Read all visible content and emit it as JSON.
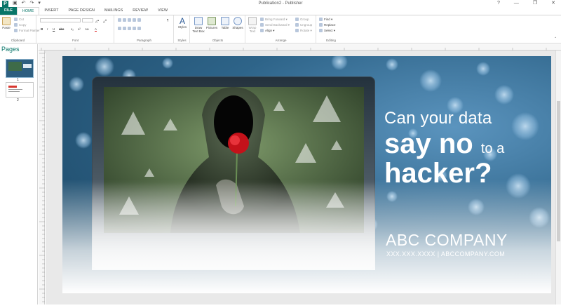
{
  "app": {
    "window_title": "Publication2 - Publisher",
    "colors": {
      "accent": "#077568",
      "ribbon_bg": "#ffffff",
      "workspace": "#e9e9e9"
    }
  },
  "qat": {
    "logo": "P",
    "save_icon": "save-icon",
    "undo": "↶",
    "redo": "↷"
  },
  "window_controls": {
    "help": "?",
    "minimize": "—",
    "restore": "❐",
    "close": "✕"
  },
  "tabs": [
    {
      "label": "FILE"
    },
    {
      "label": "HOME"
    },
    {
      "label": "INSERT"
    },
    {
      "label": "PAGE DESIGN"
    },
    {
      "label": "MAILINGS"
    },
    {
      "label": "REVIEW"
    },
    {
      "label": "VIEW"
    }
  ],
  "ribbon": {
    "clipboard": {
      "label": "Clipboard",
      "paste": "Paste",
      "cut": "Cut",
      "copy": "Copy",
      "format_painter": "Format Painter"
    },
    "font": {
      "label": "Font",
      "bold": "B",
      "italic": "I",
      "underline": "U",
      "strike": "abc"
    },
    "paragraph": {
      "label": "Paragraph"
    },
    "styles": {
      "label": "Styles",
      "button": "Styles"
    },
    "objects": {
      "label": "Objects",
      "draw_text_box": "Draw Text Box",
      "pictures": "Pictures",
      "table": "Table",
      "shapes": "Shapes"
    },
    "arrange": {
      "label": "Arrange",
      "wrap_text": "Wrap Text",
      "bring_forward": "Bring Forward",
      "send_backward": "Send Backward",
      "align": "Align",
      "group": "Group",
      "ungroup": "Ungroup",
      "rotate": "Rotate"
    },
    "editing": {
      "label": "Editing",
      "find": "Find",
      "replace": "Replace",
      "select": "Select"
    }
  },
  "pages_panel": {
    "title": "Pages",
    "pages": [
      {
        "number": "1",
        "selected": true
      },
      {
        "number": "2",
        "selected": false
      }
    ]
  },
  "publication": {
    "headline_line1": "Can your data",
    "headline_bold": "say no",
    "headline_small": "to a",
    "headline_line3": "hacker?",
    "company": "ABC COMPANY",
    "contact": "XXX.XXX.XXXX   |   ABCCOMPANY.COM"
  }
}
